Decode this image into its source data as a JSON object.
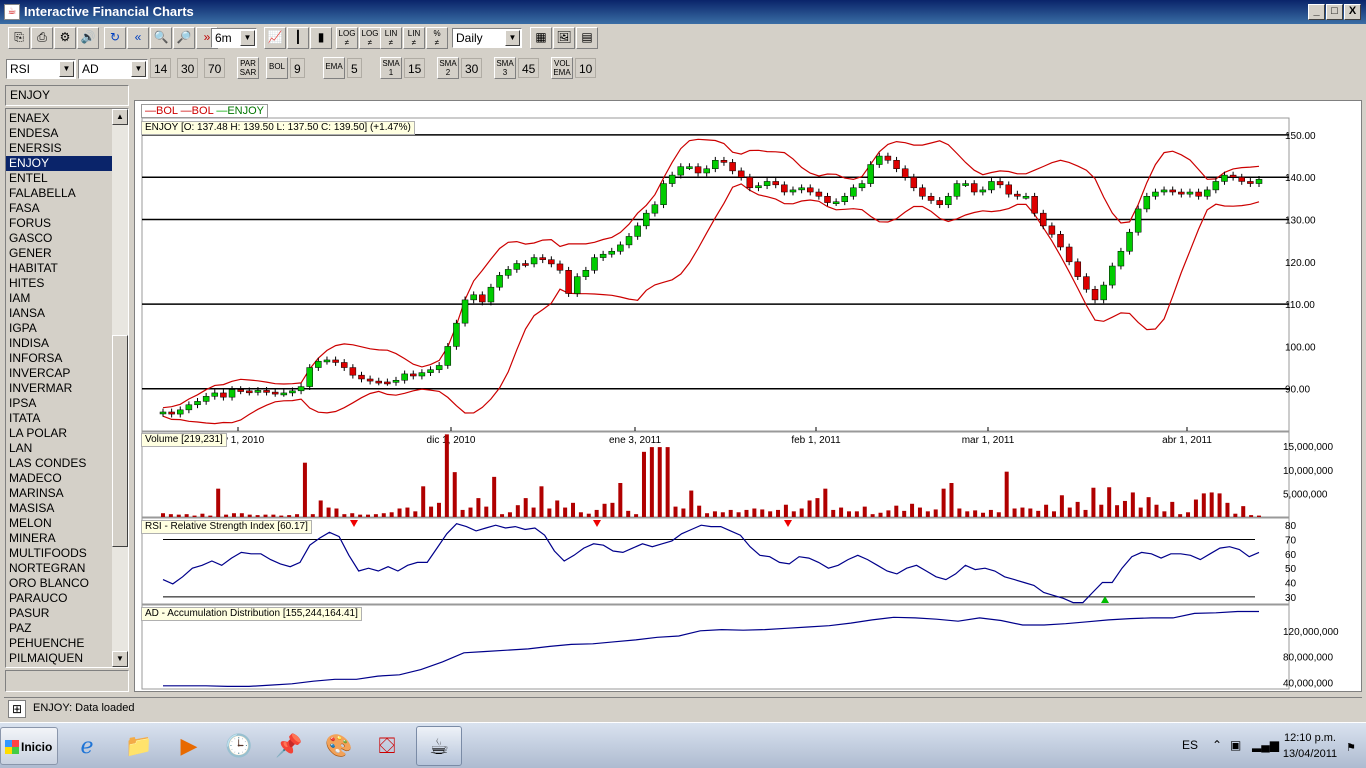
{
  "window": {
    "title": "Interactive Financial Charts",
    "controls": [
      "_",
      "□",
      "X"
    ]
  },
  "toolbar1": {
    "period": "6m",
    "interval": "Daily",
    "scale_buttons": [
      {
        "top": "LOG",
        "bottom": "≠"
      },
      {
        "top": "LOG",
        "bottom": "≠"
      },
      {
        "top": "LIN",
        "bottom": "≠"
      },
      {
        "top": "LIN",
        "bottom": "≠"
      },
      {
        "top": "%",
        "bottom": "≠"
      }
    ]
  },
  "toolbar2": {
    "indicator1": "RSI",
    "indicator2": "AD",
    "rsi_params": [
      "14",
      "30",
      "70"
    ],
    "par_sar": {
      "top": "PAR",
      "bottom": "SAR"
    },
    "bol": {
      "label": "BOL",
      "value": "9"
    },
    "ema": {
      "label": "EMA",
      "value": "5"
    },
    "sma1": {
      "top": "SMA",
      "bottom": "1",
      "value": "15"
    },
    "sma2": {
      "top": "SMA",
      "bottom": "2",
      "value": "30"
    },
    "sma3": {
      "top": "SMA",
      "bottom": "3",
      "value": "45"
    },
    "vol_ema": {
      "top": "VOL",
      "bottom": "EMA",
      "value": "10"
    }
  },
  "symbols": {
    "current": "ENJOY",
    "selected": "ENJOY",
    "items": [
      "ENAEX",
      "ENDESA",
      "ENERSIS",
      "ENJOY",
      "ENTEL",
      "FALABELLA",
      "FASA",
      "FORUS",
      "GASCO",
      "GENER",
      "HABITAT",
      "HITES",
      "IAM",
      "IANSA",
      "IGPA",
      "INDISA",
      "INFORSA",
      "INVERCAP",
      "INVERMAR",
      "IPSA",
      "ITATA",
      "LA POLAR",
      "LAN",
      "LAS CONDES",
      "MADECO",
      "MARINSA",
      "MASISA",
      "MELON",
      "MINERA",
      "MULTIFOODS",
      "NORTEGRAN",
      "ORO BLANCO",
      "PARAUCO",
      "PASUR",
      "PAZ",
      "PEHUENCHE",
      "PILMAIQUEN"
    ]
  },
  "legend": [
    {
      "name": "BOL",
      "color": "#cc0000"
    },
    {
      "name": "BOL",
      "color": "#cc0000"
    },
    {
      "name": "ENJOY",
      "color": "#00aa00"
    }
  ],
  "price_panel": {
    "title": "ENJOY [O: 137.48  H: 139.50  L: 137.50  C: 139.50] (+1.47%)"
  },
  "volume_panel": {
    "title": "Volume [219,231]"
  },
  "rsi_panel": {
    "title": "RSI - Relative Strength Index [60.17]"
  },
  "ad_panel": {
    "title": "AD - Accumulation Distribution [155,244,164.41]"
  },
  "chart_data": [
    {
      "type": "candlestick",
      "title": "ENJOY [O: 137.48  H: 139.50  L: 137.50  C: 139.50] (+1.47%)",
      "x_tick_labels": [
        "nov 1, 2010",
        "dic 1, 2010",
        "ene 3, 2011",
        "feb 1, 2011",
        "mar 1, 2011",
        "abr 1, 2011"
      ],
      "y_tick_labels": [
        "150.00",
        "140.00",
        "130.00",
        "120.00",
        "110.00",
        "100.00",
        "90.00"
      ],
      "y_ticks": [
        150,
        140,
        130,
        120,
        110,
        100,
        90
      ],
      "horizontal_lines": [
        150,
        140,
        130,
        110,
        90
      ],
      "ylim": [
        80,
        154
      ],
      "close": [
        84.5,
        84.0,
        85.0,
        86.2,
        87.0,
        88.2,
        89.0,
        88.0,
        89.8,
        89.5,
        89.2,
        89.6,
        89.2,
        88.9,
        89.0,
        89.5,
        90.5,
        95.0,
        96.5,
        96.8,
        96.2,
        95.0,
        93.2,
        92.3,
        91.8,
        91.6,
        91.5,
        92.0,
        93.5,
        93.0,
        93.8,
        94.5,
        95.5,
        100.0,
        105.5,
        111.0,
        112.2,
        110.5,
        114.0,
        116.8,
        118.2,
        119.6,
        119.5,
        121.0,
        120.5,
        119.5,
        118.0,
        112.5,
        116.5,
        118.0,
        121.0,
        121.8,
        122.5,
        124.0,
        126.0,
        128.5,
        131.5,
        133.5,
        138.5,
        140.5,
        142.5,
        142.5,
        141.0,
        142.0,
        144.0,
        143.5,
        141.5,
        140.0,
        137.5,
        138.0,
        139.0,
        138.2,
        136.5,
        137.0,
        137.5,
        136.5,
        135.5,
        134.0,
        134.2,
        135.5,
        137.5,
        138.5,
        143.0,
        145.0,
        144.0,
        142.0,
        140.0,
        137.5,
        135.5,
        134.5,
        133.5,
        135.5,
        138.5,
        138.5,
        136.5,
        137.0,
        139.0,
        138.2,
        136.0,
        135.5,
        135.5,
        131.5,
        128.5,
        126.5,
        123.5,
        120.0,
        116.5,
        113.5,
        111.0,
        114.5,
        119.0,
        122.5,
        127.0,
        132.5,
        135.5,
        136.5,
        137.0,
        136.5,
        136.0,
        136.5,
        135.5,
        137.0,
        139.0,
        140.5,
        140.0,
        139.0,
        138.5,
        139.5
      ]
    },
    {
      "type": "bar",
      "title": "Volume [219,231]",
      "y_tick_labels": [
        "15,000,000",
        "10,000,000",
        "5,000,000"
      ],
      "y_ticks": [
        15000000,
        10000000,
        5000000
      ],
      "ylim": [
        0,
        18000000
      ],
      "values": [
        800000,
        600000,
        500000,
        600000,
        300000,
        700000,
        300000,
        6000000,
        500000,
        800000,
        800000,
        500000,
        400000,
        500000,
        500000,
        300000,
        400000,
        600000,
        11500000,
        600000,
        3500000,
        2000000,
        1800000,
        600000,
        800000,
        500000,
        500000,
        600000,
        800000,
        1000000,
        1800000,
        2000000,
        1200000,
        6500000,
        2200000,
        3000000,
        17500000,
        9500000,
        1500000,
        2000000,
        4000000,
        2200000,
        8500000,
        600000,
        1000000,
        2500000,
        4000000,
        2000000,
        6500000,
        1800000,
        3500000,
        2000000,
        3000000,
        1000000,
        700000,
        1500000,
        2800000,
        3000000,
        7200000,
        1300000,
        600000,
        13800000,
        14800000,
        14800000,
        14800000,
        2200000,
        1800000,
        5600000,
        2400000,
        800000,
        1200000,
        1000000,
        1500000,
        1000000,
        1500000,
        1800000,
        1600000,
        1200000,
        1500000,
        2600000,
        1200000,
        1800000,
        3500000,
        4000000,
        6000000,
        1500000,
        2000000,
        1200000,
        1200000,
        2200000,
        600000,
        900000,
        1400000,
        2400000,
        1300000,
        2800000,
        2000000,
        1200000,
        1600000,
        6000000,
        7200000,
        1800000,
        1200000,
        1400000,
        900000,
        1500000,
        1000000,
        9600000,
        1800000,
        2000000,
        1800000,
        1300000,
        2600000,
        1200000,
        4600000,
        2000000,
        3200000,
        1500000,
        6200000,
        2600000,
        6300000,
        2500000,
        3400000,
        5200000,
        2000000,
        4200000,
        2600000,
        1200000,
        3200000,
        600000,
        1000000,
        3700000,
        5000000,
        5200000,
        5000000,
        3000000,
        700000,
        2300000,
        400000,
        300000
      ]
    },
    {
      "type": "line",
      "title": "RSI - Relative Strength Index [60.17]",
      "y_tick_labels": [
        "80",
        "70",
        "60",
        "50",
        "40",
        "30"
      ],
      "y_ticks": [
        80,
        70,
        60,
        50,
        40,
        30
      ],
      "horizontal_lines": [
        70,
        30
      ],
      "ylim": [
        25,
        85
      ],
      "values": [
        42,
        39,
        44,
        50,
        52,
        55,
        52,
        57,
        61,
        60,
        60,
        56,
        53,
        51,
        54,
        66,
        71,
        75,
        72,
        59,
        48,
        50,
        48,
        51,
        48,
        52,
        54,
        54,
        64,
        74,
        81,
        79,
        76,
        78,
        80,
        78,
        79,
        77,
        78,
        73,
        62,
        55,
        59,
        64,
        67,
        66,
        62,
        61,
        64,
        67,
        65,
        67,
        69,
        74,
        77,
        80,
        79,
        79,
        76,
        73,
        65,
        59,
        58,
        54,
        53,
        58,
        57,
        54,
        50,
        52,
        56,
        59,
        56,
        52,
        48,
        46,
        50,
        52,
        48,
        44,
        42,
        46,
        52,
        49,
        50,
        48,
        44,
        42,
        40,
        38,
        33,
        31,
        29,
        26,
        26,
        33,
        40,
        40,
        50,
        58,
        61,
        60,
        57,
        60,
        60,
        59,
        56,
        60,
        64,
        65,
        63,
        58,
        61
      ]
    },
    {
      "type": "line",
      "title": "AD - Accumulation Distribution [155,244,164.41]",
      "y_tick_labels": [
        "120,000,000",
        "80,000,000",
        "40,000,000"
      ],
      "y_ticks": [
        120000000,
        80000000,
        40000000
      ],
      "ylim": [
        30000000,
        160000000
      ],
      "values": [
        35000000,
        35000000,
        35000000,
        34000000,
        34000000,
        36000000,
        38000000,
        42000000,
        45000000,
        45000000,
        50000000,
        52000000,
        60000000,
        72000000,
        86000000,
        88000000,
        90000000,
        92000000,
        96000000,
        99000000,
        100000000,
        103000000,
        106000000,
        110000000,
        112000000,
        120000000,
        122000000,
        121000000,
        122000000,
        124000000,
        126000000,
        128000000,
        132000000,
        137000000,
        141000000,
        140000000,
        138000000,
        135000000,
        140000000,
        136000000,
        129000000,
        129000000,
        131000000,
        134000000,
        137000000,
        139000000,
        140000000,
        140000000,
        147000000,
        148000000,
        150000000,
        150000000
      ]
    }
  ],
  "status": {
    "text": "ENJOY: Data loaded"
  },
  "taskbar": {
    "start_label": "Inicio",
    "language": "ES",
    "time": "12:10 p.m.",
    "date": "13/04/2011"
  }
}
